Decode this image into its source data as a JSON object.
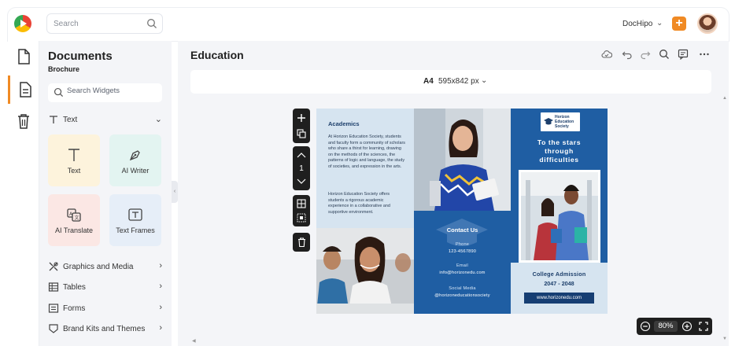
{
  "topbar": {
    "search_placeholder": "Search",
    "brand_label": "DocHipo",
    "add_label": "+"
  },
  "panel": {
    "title": "Documents",
    "subtitle": "Brochure",
    "widget_search_placeholder": "Search Widgets",
    "text_section_label": "Text",
    "cards": [
      {
        "label": "Text",
        "icon": "text-t-icon",
        "bg": "#fdf3dc"
      },
      {
        "label": "AI Writer",
        "icon": "pen-nib-icon",
        "bg": "#e3f4f1"
      },
      {
        "label": "AI Translate",
        "icon": "translate-icon",
        "bg": "#fbe7e4"
      },
      {
        "label": "Text Frames",
        "icon": "text-frame-icon",
        "bg": "#e6eef8"
      }
    ],
    "sections": [
      {
        "label": "Graphics and Media",
        "icon": "graphics-icon"
      },
      {
        "label": "Tables",
        "icon": "table-icon"
      },
      {
        "label": "Forms",
        "icon": "form-icon"
      },
      {
        "label": "Brand Kits and Themes",
        "icon": "brand-kit-icon"
      }
    ]
  },
  "editor": {
    "doc_title": "Education",
    "page_size_label": "A4",
    "page_size_dims": "595x842 px",
    "page_number": "1",
    "zoom": "80%"
  },
  "brochure": {
    "academics_heading": "Academics",
    "academics_p1": "At Horizon Education Society, students and faculty form a community of scholars who share a thirst for learning, drawing on the methods of the sciences, the patterns of logic and language, the study of societies, and expression in the arts.",
    "academics_p2": "Horizon Education Society offers students a rigorous academic experience in a collaborative and supportive environment.",
    "contact_heading": "Contact Us",
    "phone_label": "Phone",
    "phone_value": "123-4567890",
    "email_label": "Email",
    "email_value": "info@horizonedu.com",
    "social_label": "Social Media",
    "social_value": "@horizoneducationsociety",
    "logo_text": "Horizon Education Society",
    "tagline_1": "To the stars",
    "tagline_2": "through",
    "tagline_3": "difficulties",
    "admission_title": "College Admission",
    "admission_years": "2047 - 2048",
    "website": "www.horizonedu.com"
  },
  "colors": {
    "accent": "#f08a24",
    "brochure_blue": "#1f5ea3",
    "brochure_light": "#d6e4f0",
    "dark_navy": "#163e73"
  }
}
